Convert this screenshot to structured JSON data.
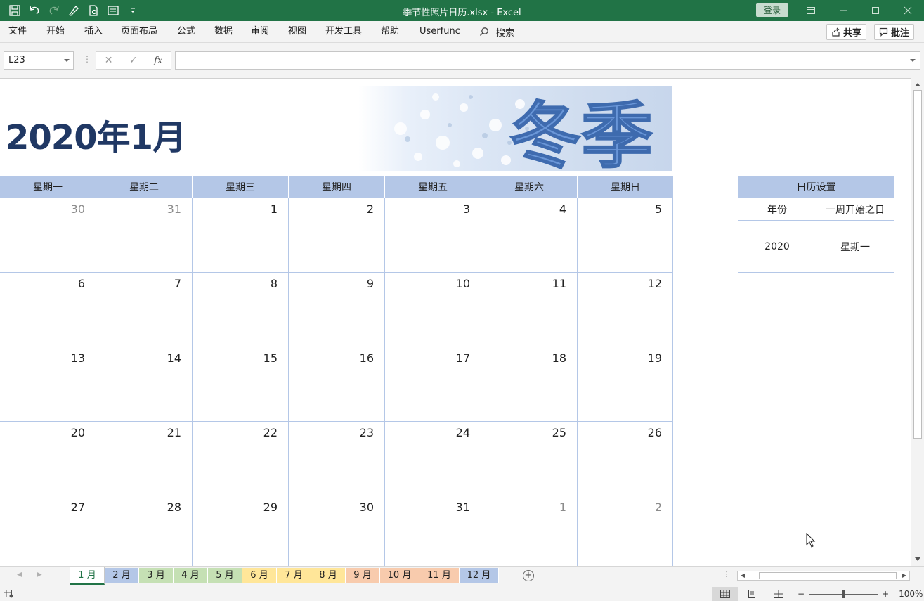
{
  "window": {
    "title": "季节性照片日历.xlsx  -  Excel",
    "login_label": "登录"
  },
  "menu": {
    "items": [
      "文件",
      "开始",
      "插入",
      "页面布局",
      "公式",
      "数据",
      "审阅",
      "视图",
      "开发工具",
      "帮助",
      "Userfunc"
    ],
    "search_label": "搜索",
    "share_label": "共享",
    "comments_label": "批注"
  },
  "formula_bar": {
    "name_box": "L23",
    "fx_label": "fx",
    "formula": ""
  },
  "calendar": {
    "title": "2020年1月",
    "banner_text": "冬季",
    "weekdays": [
      "星期一",
      "星期二",
      "星期三",
      "星期四",
      "星期五",
      "星期六",
      "星期日"
    ],
    "weeks": [
      [
        {
          "d": "30",
          "other": true
        },
        {
          "d": "31",
          "other": true
        },
        {
          "d": "1",
          "other": false
        },
        {
          "d": "2",
          "other": false
        },
        {
          "d": "3",
          "other": false
        },
        {
          "d": "4",
          "other": false
        },
        {
          "d": "5",
          "other": false
        }
      ],
      [
        {
          "d": "6",
          "other": false
        },
        {
          "d": "7",
          "other": false
        },
        {
          "d": "8",
          "other": false
        },
        {
          "d": "9",
          "other": false
        },
        {
          "d": "10",
          "other": false
        },
        {
          "d": "11",
          "other": false
        },
        {
          "d": "12",
          "other": false
        }
      ],
      [
        {
          "d": "13",
          "other": false
        },
        {
          "d": "14",
          "other": false
        },
        {
          "d": "15",
          "other": false
        },
        {
          "d": "16",
          "other": false
        },
        {
          "d": "17",
          "other": false
        },
        {
          "d": "18",
          "other": false
        },
        {
          "d": "19",
          "other": false
        }
      ],
      [
        {
          "d": "20",
          "other": false
        },
        {
          "d": "21",
          "other": false
        },
        {
          "d": "22",
          "other": false
        },
        {
          "d": "23",
          "other": false
        },
        {
          "d": "24",
          "other": false
        },
        {
          "d": "25",
          "other": false
        },
        {
          "d": "26",
          "other": false
        }
      ],
      [
        {
          "d": "27",
          "other": false
        },
        {
          "d": "28",
          "other": false
        },
        {
          "d": "29",
          "other": false
        },
        {
          "d": "30",
          "other": false
        },
        {
          "d": "31",
          "other": false
        },
        {
          "d": "1",
          "other": true
        },
        {
          "d": "2",
          "other": true
        }
      ]
    ]
  },
  "settings": {
    "title": "日历设置",
    "year_label": "年份",
    "weekstart_label": "一周开始之日",
    "year_value": "2020",
    "weekstart_value": "星期一"
  },
  "sheet_tabs": [
    {
      "label": "1 月",
      "color": "#ffffff",
      "active": true
    },
    {
      "label": "2 月",
      "color": "#b4c7e7",
      "active": false
    },
    {
      "label": "3 月",
      "color": "#c5e0b4",
      "active": false
    },
    {
      "label": "4 月",
      "color": "#c5e0b4",
      "active": false
    },
    {
      "label": "5 月",
      "color": "#c5e0b4",
      "active": false
    },
    {
      "label": "6 月",
      "color": "#ffe699",
      "active": false
    },
    {
      "label": "7 月",
      "color": "#ffe699",
      "active": false
    },
    {
      "label": "8 月",
      "color": "#ffe699",
      "active": false
    },
    {
      "label": "9 月",
      "color": "#f8cbad",
      "active": false
    },
    {
      "label": "10 月",
      "color": "#f8cbad",
      "active": false
    },
    {
      "label": "11 月",
      "color": "#f8cbad",
      "active": false
    },
    {
      "label": "12 月",
      "color": "#b4c7e7",
      "active": false
    }
  ],
  "status": {
    "zoom": "100%",
    "zoom_fraction": 0.5
  },
  "colors": {
    "excel_green": "#217346",
    "header_blue": "#b4c7e7",
    "title_navy": "#203864"
  }
}
